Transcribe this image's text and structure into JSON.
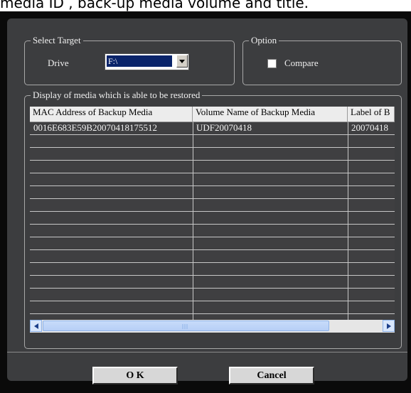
{
  "caption": "media ID , back-up media volume and title.",
  "select_target": {
    "legend": "Select Target",
    "drive_label": "Drive",
    "drive_value": "F:\\"
  },
  "option": {
    "legend": "Option",
    "compare_label": "Compare",
    "compare_checked": false
  },
  "media_list": {
    "legend": "Display of media which is able to be restored",
    "columns": [
      "MAC Address of Backup Media",
      "Volume Name of Backup Media",
      "Label of B"
    ],
    "rows": [
      [
        "0016E683E59B20070418175512",
        "UDF20070418",
        "20070418"
      ]
    ]
  },
  "buttons": {
    "ok": "O K",
    "cancel": "Cancel"
  },
  "colors": {
    "dialog_frame": "#0a0a0a",
    "panel": "#3c3d3f",
    "selection": "#0a246a",
    "scroll": "#d8e6fb"
  },
  "icons": {
    "dropdown": "chevron-down-icon",
    "scroll_left": "arrow-left-icon",
    "scroll_right": "arrow-right-icon"
  }
}
